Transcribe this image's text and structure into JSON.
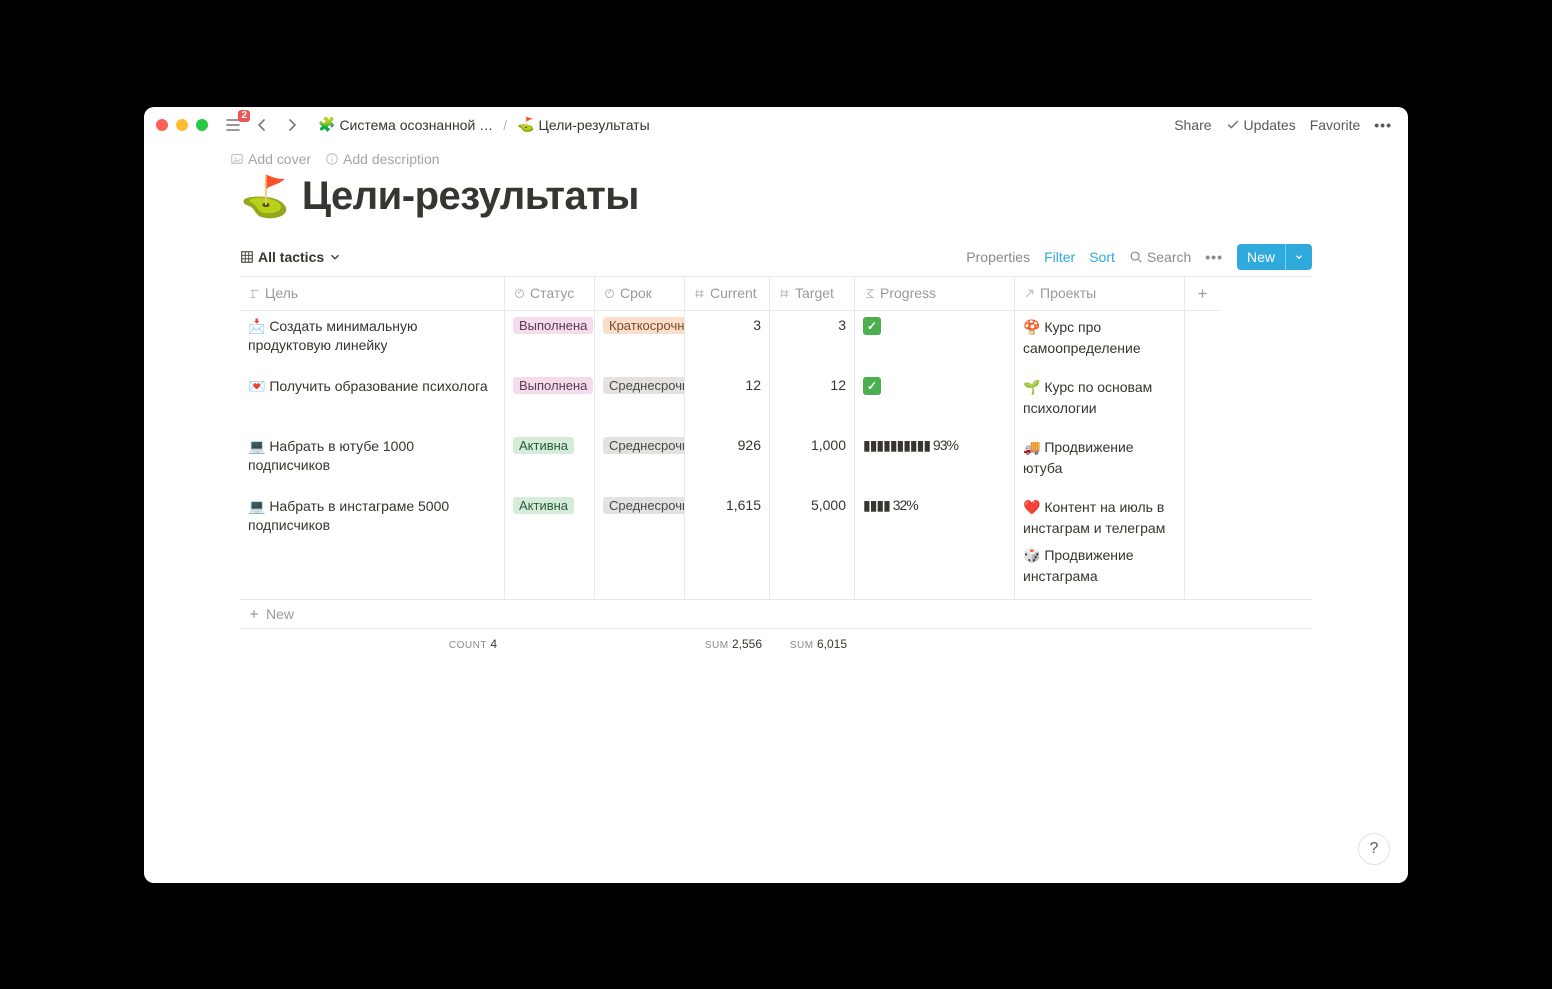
{
  "window": {
    "sidebar_badge": "2"
  },
  "breadcrumb": {
    "root_emoji": "🧩",
    "root_label": "Система осознанной …",
    "current_emoji": "⛳",
    "current_label": "Цели-результаты"
  },
  "topbar": {
    "share": "Share",
    "updates": "Updates",
    "favorite": "Favorite"
  },
  "page": {
    "add_cover": "Add cover",
    "add_description": "Add description",
    "title_emoji": "⛳",
    "title": "Цели-результаты"
  },
  "viewbar": {
    "view_name": "All tactics",
    "properties": "Properties",
    "filter": "Filter",
    "sort": "Sort",
    "search": "Search",
    "new": "New"
  },
  "columns": {
    "goal": "Цель",
    "status": "Статус",
    "term": "Срок",
    "current": "Current",
    "target": "Target",
    "progress": "Progress",
    "projects": "Проекты"
  },
  "rows": [
    {
      "goal_emoji": "📩",
      "goal": "Создать минимальную продуктовую линейку",
      "status": "Выполнена",
      "status_class": "tag-done",
      "term": "Краткосрочн",
      "term_class": "tag-short",
      "current": "3",
      "target": "3",
      "progress_html": "✅",
      "progress_check": true,
      "projects": [
        {
          "emoji": "🍄",
          "label": "Курс про самоопределение"
        }
      ]
    },
    {
      "goal_emoji": "💌",
      "goal": "Получить образование психолога",
      "status": "Выполнена",
      "status_class": "tag-done",
      "term": "Среднесрочн",
      "term_class": "tag-mid",
      "current": "12",
      "target": "12",
      "progress_html": "✅",
      "progress_check": true,
      "projects": [
        {
          "emoji": "🌱",
          "label": "Курс по основам психологии"
        }
      ]
    },
    {
      "goal_emoji": "💻",
      "goal": "Набрать в ютубе 1000 подписчиков",
      "status": "Активна",
      "status_class": "tag-active",
      "term": "Среднесрочн",
      "term_class": "tag-mid",
      "current": "926",
      "target": "1,000",
      "progress_html": "▮▮▮▮▮▮▮▮▮▮ 93%",
      "progress_check": false,
      "projects": [
        {
          "emoji": "🚚",
          "label": "Продвижение ютуба"
        }
      ]
    },
    {
      "goal_emoji": "💻",
      "goal": "Набрать в инстаграме 5000 подписчиков",
      "status": "Активна",
      "status_class": "tag-active",
      "term": "Среднесрочн",
      "term_class": "tag-mid",
      "current": "1,615",
      "target": "5,000",
      "progress_html": "▮▮▮▮ 32%",
      "progress_check": false,
      "projects": [
        {
          "emoji": "❤️",
          "label": "Контент на июль в инстаграм и телеграм"
        },
        {
          "emoji": "🎲",
          "label": "Продвижение инстаграма"
        }
      ]
    }
  ],
  "footer": {
    "new_label": "New",
    "count_label": "COUNT",
    "count_value": "4",
    "sum_label": "SUM",
    "sum_current": "2,556",
    "sum_target": "6,015"
  }
}
